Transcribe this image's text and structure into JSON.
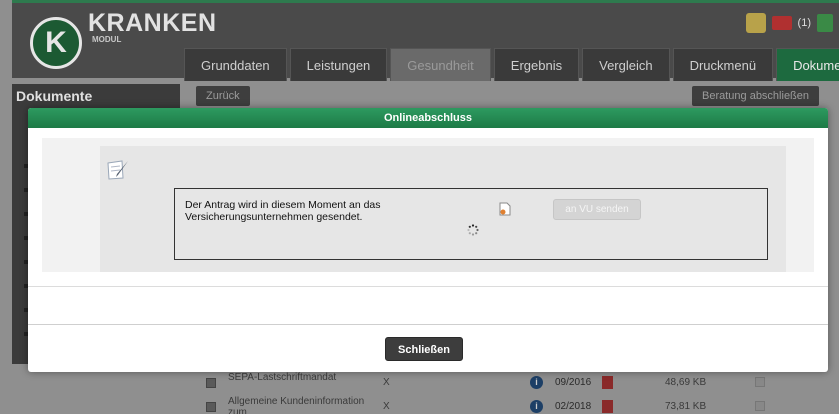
{
  "brand": {
    "name": "KRANKEN",
    "subtitle": "MODUL",
    "letter": "K"
  },
  "header": {
    "notification_count": "(1)"
  },
  "tabs": [
    {
      "label": "Grunddaten"
    },
    {
      "label": "Leistungen"
    },
    {
      "label": "Gesundheit"
    },
    {
      "label": "Ergebnis"
    },
    {
      "label": "Vergleich"
    },
    {
      "label": "Druckmenü"
    },
    {
      "label": "Dokumente"
    }
  ],
  "sidebar": {
    "title": "Dokumente"
  },
  "toolbar": {
    "back_label": "Zurück",
    "finish_label": "Beratung abschließen"
  },
  "documents": [
    {
      "name": "SEPA-Lastschriftmandat",
      "required": "X",
      "date": "09/2016",
      "size": "48,69 KB"
    },
    {
      "name": "Allgemeine Kundeninformation zum",
      "required": "X",
      "date": "02/2018",
      "size": "73,81 KB"
    }
  ],
  "modal": {
    "title": "Onlineabschluss",
    "message": "Der Antrag wird in diesem Moment an das Versicherungsunternehmen gesendet.",
    "send_label": "an VU senden",
    "close_label": "Schließen"
  },
  "colors": {
    "accent": "#1d7a46",
    "header_green": "#2d9a60",
    "close_button": "#3d3d3d"
  }
}
